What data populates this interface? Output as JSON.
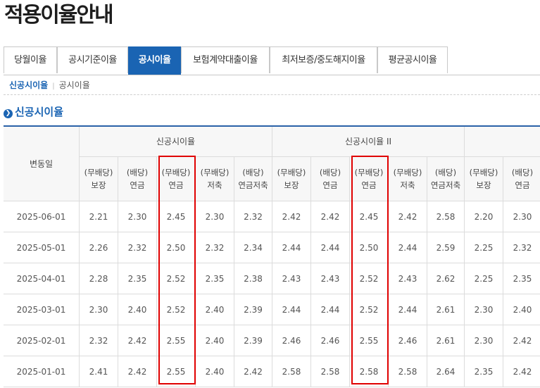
{
  "page": {
    "title": "적용이율안내"
  },
  "tabs": [
    {
      "label": "당월이율",
      "active": false
    },
    {
      "label": "공시기준이율",
      "active": false
    },
    {
      "label": "공시이율",
      "active": true
    },
    {
      "label": "보험계약대출이율",
      "active": false
    },
    {
      "label": "최저보증/중도해지이율",
      "active": false
    },
    {
      "label": "평균공시이율",
      "active": false
    }
  ],
  "subnav": {
    "current": "신공시이율",
    "separator": "|",
    "other": "공시이율"
  },
  "section": {
    "title": "신공시이율"
  },
  "table": {
    "date_header": "변동일",
    "groups": [
      "신공시이율",
      "신공시이율 II"
    ],
    "columns": [
      "(무배당)\n보장",
      "(배당)\n연금",
      "(무배당)\n연금",
      "(무배당)\n저축",
      "(배당)\n연금저축",
      "(무배당)\n보장",
      "(배당)\n연금",
      "(무배당)\n연금",
      "(무배당)\n저축",
      "(배당)\n연금저축",
      "(무배당)\n보장",
      "(배당)\n연금"
    ],
    "rows": [
      {
        "date": "2025-06-01",
        "values": [
          "2.21",
          "2.30",
          "2.45",
          "2.30",
          "2.32",
          "2.42",
          "2.42",
          "2.45",
          "2.42",
          "2.58",
          "2.20",
          "2.30"
        ]
      },
      {
        "date": "2025-05-01",
        "values": [
          "2.26",
          "2.32",
          "2.50",
          "2.32",
          "2.34",
          "2.44",
          "2.44",
          "2.50",
          "2.44",
          "2.59",
          "2.25",
          "2.32"
        ]
      },
      {
        "date": "2025-04-01",
        "values": [
          "2.28",
          "2.35",
          "2.52",
          "2.35",
          "2.38",
          "2.43",
          "2.43",
          "2.52",
          "2.43",
          "2.62",
          "2.25",
          "2.35"
        ]
      },
      {
        "date": "2025-03-01",
        "values": [
          "2.30",
          "2.40",
          "2.52",
          "2.40",
          "2.39",
          "2.44",
          "2.44",
          "2.52",
          "2.44",
          "2.61",
          "2.30",
          "2.40"
        ]
      },
      {
        "date": "2025-02-01",
        "values": [
          "2.32",
          "2.42",
          "2.55",
          "2.40",
          "2.39",
          "2.46",
          "2.46",
          "2.55",
          "2.46",
          "2.61",
          "2.30",
          "2.42"
        ]
      },
      {
        "date": "2025-01-01",
        "values": [
          "2.41",
          "2.42",
          "2.55",
          "2.40",
          "2.42",
          "2.58",
          "2.58",
          "2.58",
          "2.58",
          "2.64",
          "2.35",
          "2.42"
        ]
      }
    ],
    "highlight_columns": [
      2,
      7
    ],
    "highlight_color": "#e00000",
    "accent_color": "#1a64b3"
  }
}
